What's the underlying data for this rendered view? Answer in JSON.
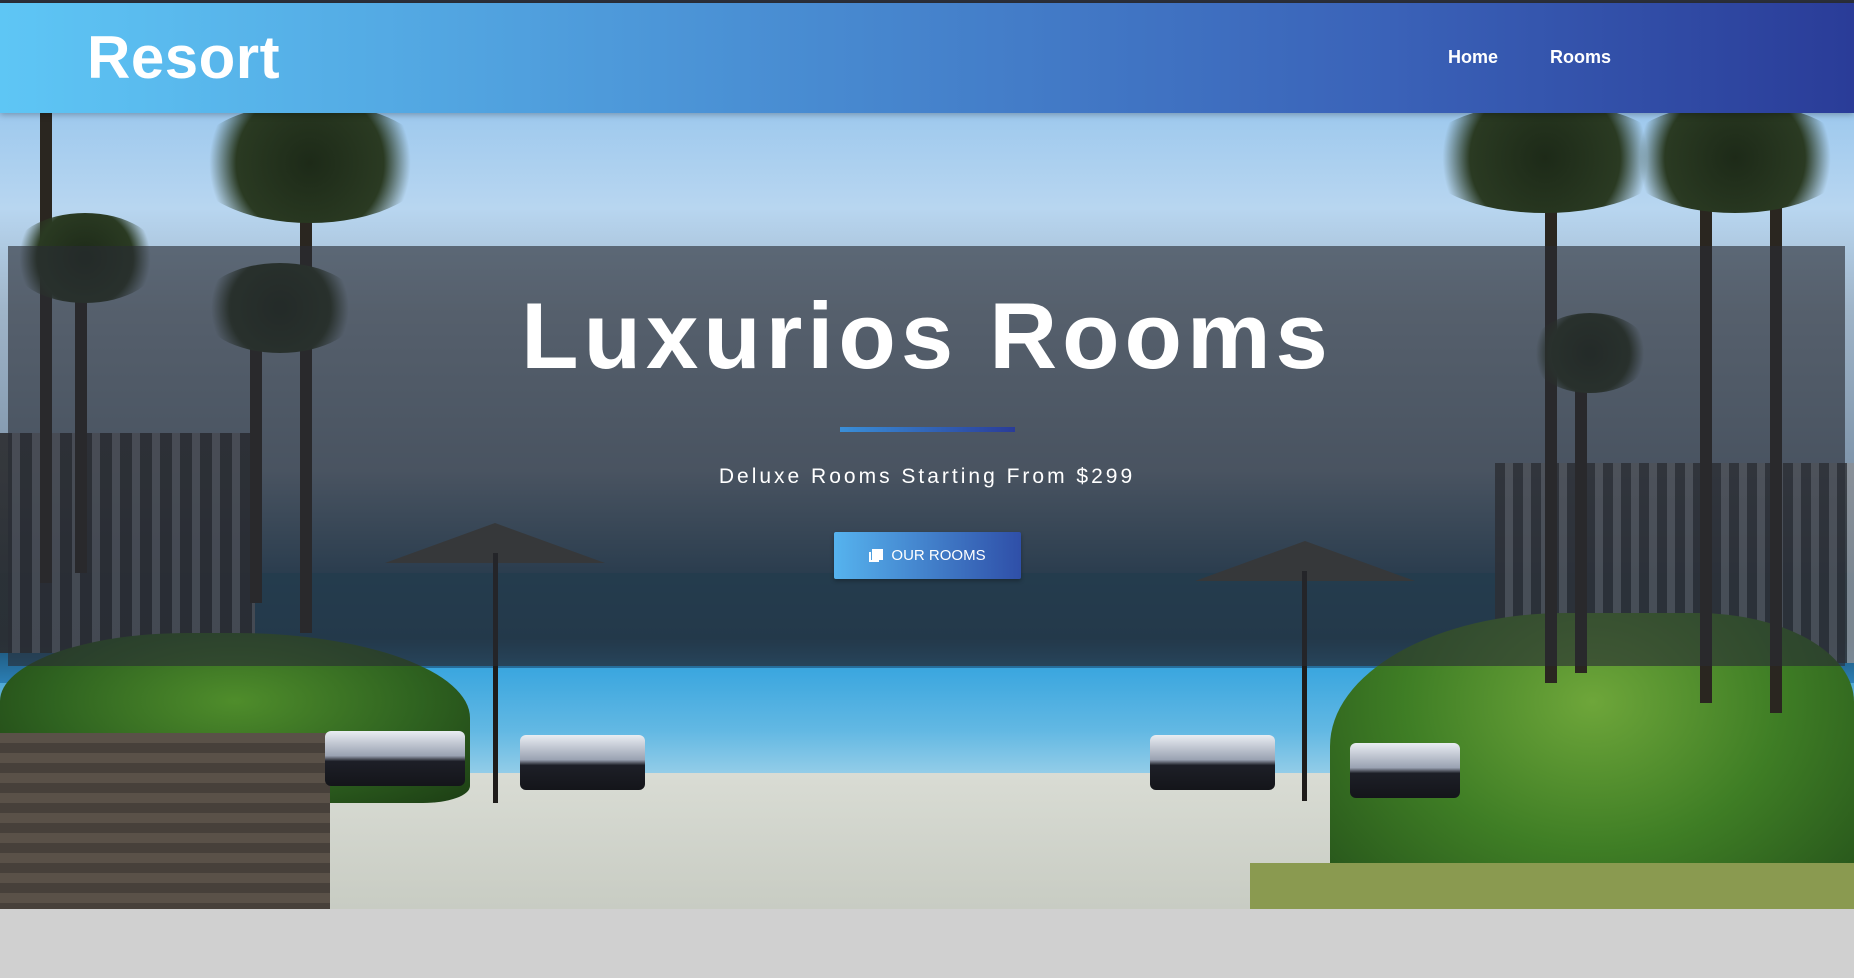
{
  "navbar": {
    "brand": "Resort",
    "links": [
      {
        "label": "Home"
      },
      {
        "label": "Rooms"
      }
    ],
    "gradient_colors": [
      "#5ec6f5",
      "#2a3c98"
    ]
  },
  "hero": {
    "title": "Luxurios Rooms",
    "subtitle": "Deluxe Rooms Starting From $299",
    "button_label": "OUR ROOMS",
    "button_icon": "clone-icon",
    "background_image": "resort-infinity-pool-photo"
  }
}
